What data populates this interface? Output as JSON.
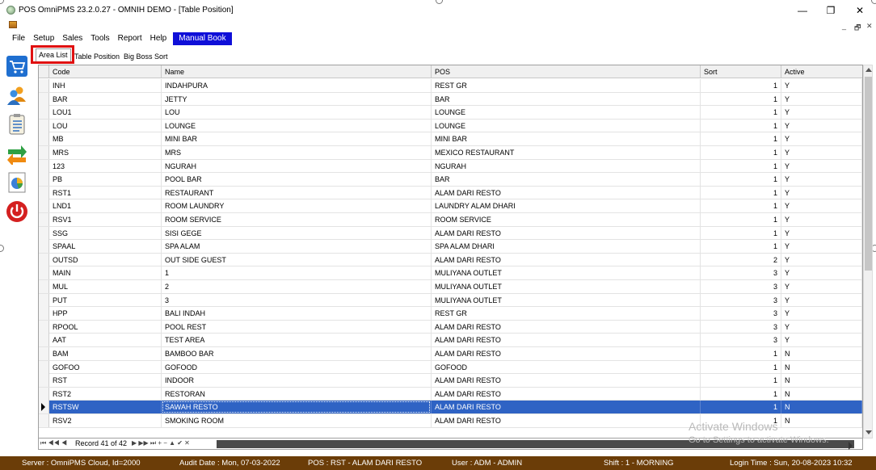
{
  "window": {
    "title": "POS OmniPMS 23.2.0.27 - OMNIH DEMO - [Table Position]",
    "minimize": "—",
    "restore": "❐",
    "close": "✕",
    "mdi_minimize": "_",
    "mdi_restore": "🗗",
    "mdi_close": "✕"
  },
  "menu": [
    {
      "label": "File"
    },
    {
      "label": "Setup"
    },
    {
      "label": "Sales"
    },
    {
      "label": "Tools"
    },
    {
      "label": "Report"
    },
    {
      "label": "Help"
    },
    {
      "label": "Manual Book"
    }
  ],
  "tabs": [
    {
      "label": "Area List",
      "active": true
    },
    {
      "label": "Table Position",
      "active": false
    },
    {
      "label": "Big Boss Sort",
      "active": false
    }
  ],
  "left_toolbar": [
    {
      "icon": "shopping-cart-icon"
    },
    {
      "icon": "users-icon"
    },
    {
      "icon": "clipboard-list-icon"
    },
    {
      "icon": "transfer-arrows-icon"
    },
    {
      "icon": "pie-chart-report-icon"
    },
    {
      "icon": "power-icon"
    }
  ],
  "grid": {
    "columns": [
      "Code",
      "Name",
      "POS",
      "Sort",
      "Active"
    ],
    "rows": [
      {
        "code": "INH",
        "name": "INDAHPURA",
        "pos": "REST GR",
        "sort": "1",
        "active": "Y"
      },
      {
        "code": "BAR",
        "name": "JETTY",
        "pos": "BAR",
        "sort": "1",
        "active": "Y"
      },
      {
        "code": "LOU1",
        "name": "LOU",
        "pos": "LOUNGE",
        "sort": "1",
        "active": "Y"
      },
      {
        "code": "LOU",
        "name": "LOUNGE",
        "pos": "LOUNGE",
        "sort": "1",
        "active": "Y"
      },
      {
        "code": "MB",
        "name": "MINI BAR",
        "pos": "MINI BAR",
        "sort": "1",
        "active": "Y"
      },
      {
        "code": "MRS",
        "name": "MRS",
        "pos": "MEXICO RESTAURANT",
        "sort": "1",
        "active": "Y"
      },
      {
        "code": "123",
        "name": "NGURAH",
        "pos": "NGURAH",
        "sort": "1",
        "active": "Y"
      },
      {
        "code": "PB",
        "name": "POOL BAR",
        "pos": "BAR",
        "sort": "1",
        "active": "Y"
      },
      {
        "code": "RST1",
        "name": "RESTAURANT",
        "pos": "ALAM DARI RESTO",
        "sort": "1",
        "active": "Y"
      },
      {
        "code": "LND1",
        "name": "ROOM LAUNDRY",
        "pos": "LAUNDRY ALAM DHARI",
        "sort": "1",
        "active": "Y"
      },
      {
        "code": "RSV1",
        "name": "ROOM SERVICE",
        "pos": "ROOM SERVICE",
        "sort": "1",
        "active": "Y"
      },
      {
        "code": "SSG",
        "name": "SISI GEGE",
        "pos": "ALAM DARI RESTO",
        "sort": "1",
        "active": "Y"
      },
      {
        "code": "SPAAL",
        "name": "SPA ALAM",
        "pos": "SPA ALAM DHARI",
        "sort": "1",
        "active": "Y"
      },
      {
        "code": "OUTSD",
        "name": "OUT SIDE GUEST",
        "pos": "ALAM DARI RESTO",
        "sort": "2",
        "active": "Y"
      },
      {
        "code": "MAIN",
        "name": "1",
        "pos": "MULIYANA OUTLET",
        "sort": "3",
        "active": "Y"
      },
      {
        "code": "MUL",
        "name": "2",
        "pos": "MULIYANA OUTLET",
        "sort": "3",
        "active": "Y"
      },
      {
        "code": "PUT",
        "name": "3",
        "pos": "MULIYANA OUTLET",
        "sort": "3",
        "active": "Y"
      },
      {
        "code": "HPP",
        "name": "BALI INDAH",
        "pos": "REST GR",
        "sort": "3",
        "active": "Y"
      },
      {
        "code": "RPOOL",
        "name": "POOL REST",
        "pos": "ALAM DARI RESTO",
        "sort": "3",
        "active": "Y"
      },
      {
        "code": "AAT",
        "name": "TEST AREA",
        "pos": "ALAM DARI RESTO",
        "sort": "3",
        "active": "Y"
      },
      {
        "code": "BAM",
        "name": "BAMBOO BAR",
        "pos": "ALAM DARI RESTO",
        "sort": "1",
        "active": "N"
      },
      {
        "code": "GOFOO",
        "name": "GOFOOD",
        "pos": "GOFOOD",
        "sort": "1",
        "active": "N"
      },
      {
        "code": "RST",
        "name": "INDOOR",
        "pos": "ALAM DARI RESTO",
        "sort": "1",
        "active": "N"
      },
      {
        "code": "RST2",
        "name": "RESTORAN",
        "pos": "ALAM DARI RESTO",
        "sort": "1",
        "active": "N"
      },
      {
        "code": "RSTSW",
        "name": "SAWAH RESTO",
        "pos": "ALAM DARI RESTO",
        "sort": "1",
        "active": "N",
        "selected": true
      },
      {
        "code": "RSV2",
        "name": "SMOKING ROOM",
        "pos": "ALAM DARI RESTO",
        "sort": "1",
        "active": "N"
      }
    ]
  },
  "navigator": {
    "record_text": "Record 41 of 42",
    "buttons_left": "⏮ ◀◀ ◀",
    "buttons_right": "▶ ▶▶ ⏭ + − ▲ ✔ ✕"
  },
  "watermark": {
    "line1": "Activate Windows",
    "line2": "Go to Settings to activate Windows."
  },
  "status": {
    "server": "Server : OmniPMS Cloud, Id=2000",
    "audit_date": "Audit Date : Mon, 07-03-2022",
    "pos": "POS : RST - ALAM DARI RESTO",
    "user": "User : ADM - ADMIN",
    "shift": "Shift : 1 - MORNING",
    "login_time": "Login Time : Sun, 20-08-2023 10:32"
  },
  "colors": {
    "status_bar": "#6b3d08",
    "selection": "#2f63c4",
    "manual_book": "#0f0fd8",
    "tab_highlight": "#e01010"
  }
}
